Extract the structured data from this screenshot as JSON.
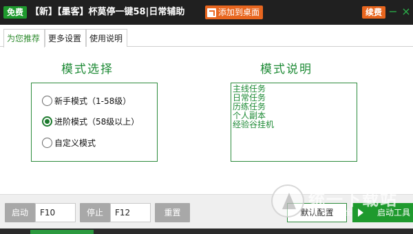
{
  "titlebar": {
    "free_badge": "免费",
    "title": "【新】【墨客】杯莫停一键58|日常辅助",
    "add_desktop": "添加到桌面",
    "renew": "续费",
    "minimize": "−",
    "close": "×"
  },
  "tabs": [
    {
      "label": "为您推荐"
    },
    {
      "label": "更多设置"
    },
    {
      "label": "使用说明"
    }
  ],
  "mode_section": {
    "title": "模式选择",
    "options": [
      {
        "label": "新手模式（1-58级）",
        "checked": false
      },
      {
        "label": "进阶模式（58级以上）",
        "checked": true
      },
      {
        "label": "自定义模式",
        "checked": false
      }
    ]
  },
  "desc_section": {
    "title": "模式说明",
    "lines": [
      "主线任务",
      "日常任务",
      "历练任务",
      "个人副本",
      "经验谷挂机"
    ]
  },
  "bottom": {
    "start_label": "启动",
    "start_key": "F10",
    "stop_label": "停止",
    "stop_key": "F12",
    "reset": "重置",
    "default_config": "默认配置",
    "launch_tool": "启动工具"
  },
  "watermark": {
    "text": "统一下载站",
    "sub": "极速安全"
  },
  "colors": {
    "accent_green": "#1f9a2e",
    "accent_orange": "#e8661f",
    "titlebar_bg": "#202020"
  }
}
